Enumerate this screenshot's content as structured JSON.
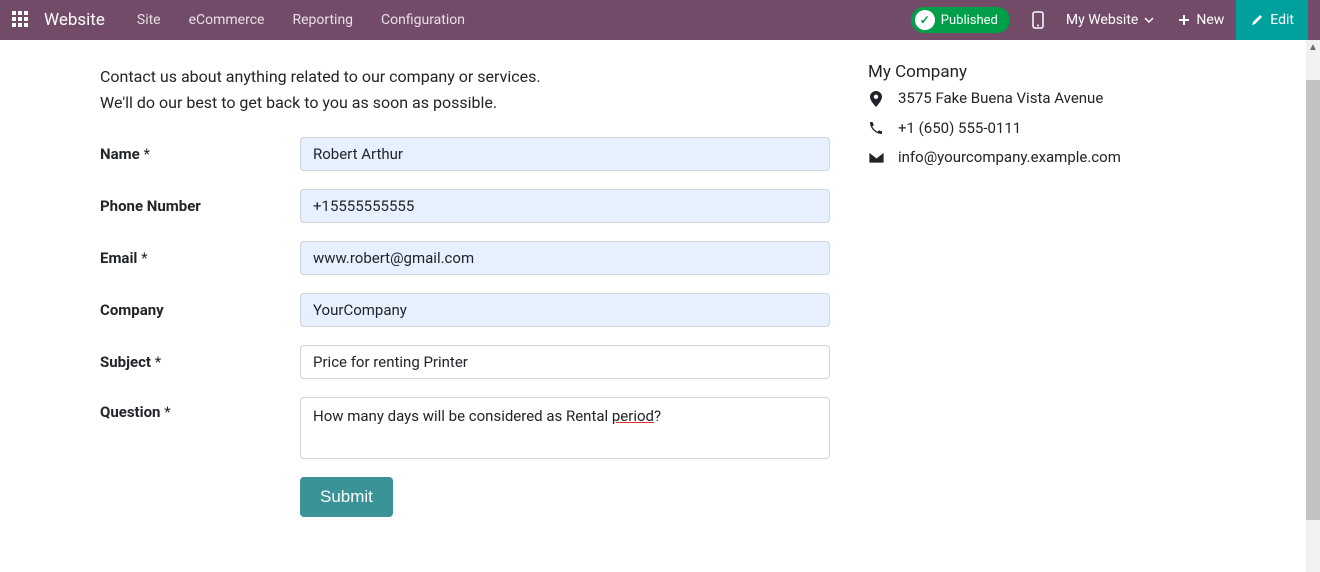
{
  "navbar": {
    "brand": "Website",
    "menu": [
      "Site",
      "eCommerce",
      "Reporting",
      "Configuration"
    ],
    "published_label": "Published",
    "website_dropdown": "My Website",
    "new_label": "New",
    "edit_label": "Edit"
  },
  "intro": {
    "line1": "Contact us about anything related to our company or services.",
    "line2": "We'll do our best to get back to you as soon as possible."
  },
  "form": {
    "labels": {
      "name": "Name",
      "phone": "Phone Number",
      "email": "Email",
      "company": "Company",
      "subject": "Subject",
      "question": "Question"
    },
    "required_mark": "*",
    "values": {
      "name": "Robert Arthur",
      "phone": "+15555555555",
      "email": "www.robert@gmail.com",
      "company": "YourCompany",
      "subject": "Price for renting Printer",
      "question_prefix": "How many days will be considered as Rental ",
      "question_underlined": "period",
      "question_suffix": "?"
    },
    "submit": "Submit"
  },
  "company": {
    "name": "My Company",
    "address": "3575 Fake Buena Vista Avenue",
    "phone": "+1 (650) 555-0111",
    "email": "info@yourcompany.example.com"
  }
}
